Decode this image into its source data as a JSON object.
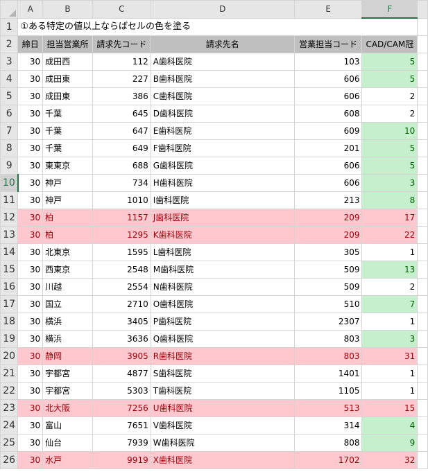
{
  "columns": [
    "A",
    "B",
    "C",
    "D",
    "E",
    "F"
  ],
  "title": "①ある特定の値以上ならばセルの色を塗る",
  "headers": [
    "締日",
    "担当営業所",
    "請求先コード",
    "請求先名",
    "営業担当コード",
    "CAD/CAM冠"
  ],
  "rows": [
    {
      "num": "1"
    },
    {
      "num": "2"
    },
    {
      "num": "3",
      "a": "30",
      "b": "成田西",
      "c": "112",
      "d": "A歯科医院",
      "e": "103",
      "f": "5",
      "hl": "green"
    },
    {
      "num": "4",
      "a": "30",
      "b": "成田東",
      "c": "227",
      "d": "B歯科医院",
      "e": "606",
      "f": "5",
      "hl": "green"
    },
    {
      "num": "5",
      "a": "30",
      "b": "成田東",
      "c": "386",
      "d": "C歯科医院",
      "e": "606",
      "f": "2",
      "hl": "none"
    },
    {
      "num": "6",
      "a": "30",
      "b": "千葉",
      "c": "645",
      "d": "D歯科医院",
      "e": "608",
      "f": "2",
      "hl": "none"
    },
    {
      "num": "7",
      "a": "30",
      "b": "千葉",
      "c": "647",
      "d": "E歯科医院",
      "e": "609",
      "f": "10",
      "hl": "green"
    },
    {
      "num": "8",
      "a": "30",
      "b": "千葉",
      "c": "649",
      "d": "F歯科医院",
      "e": "201",
      "f": "5",
      "hl": "green"
    },
    {
      "num": "9",
      "a": "30",
      "b": "東東京",
      "c": "688",
      "d": "G歯科医院",
      "e": "606",
      "f": "5",
      "hl": "green"
    },
    {
      "num": "10",
      "a": "30",
      "b": "神戸",
      "c": "734",
      "d": "H歯科医院",
      "e": "606",
      "f": "3",
      "hl": "green"
    },
    {
      "num": "11",
      "a": "30",
      "b": "神戸",
      "c": "1010",
      "d": "I歯科医院",
      "e": "213",
      "f": "8",
      "hl": "green"
    },
    {
      "num": "12",
      "a": "30",
      "b": "柏",
      "c": "1157",
      "d": "J歯科医院",
      "e": "209",
      "f": "17",
      "hl": "pink"
    },
    {
      "num": "13",
      "a": "30",
      "b": "柏",
      "c": "1295",
      "d": "K歯科医院",
      "e": "209",
      "f": "22",
      "hl": "pink"
    },
    {
      "num": "14",
      "a": "30",
      "b": "北東京",
      "c": "1595",
      "d": "L歯科医院",
      "e": "305",
      "f": "1",
      "hl": "none"
    },
    {
      "num": "15",
      "a": "30",
      "b": "西東京",
      "c": "2548",
      "d": "M歯科医院",
      "e": "509",
      "f": "13",
      "hl": "green"
    },
    {
      "num": "16",
      "a": "30",
      "b": "川越",
      "c": "2554",
      "d": "N歯科医院",
      "e": "509",
      "f": "2",
      "hl": "none"
    },
    {
      "num": "17",
      "a": "30",
      "b": "国立",
      "c": "2710",
      "d": "O歯科医院",
      "e": "510",
      "f": "7",
      "hl": "green"
    },
    {
      "num": "18",
      "a": "30",
      "b": "横浜",
      "c": "3405",
      "d": "P歯科医院",
      "e": "2307",
      "f": "1",
      "hl": "none"
    },
    {
      "num": "19",
      "a": "30",
      "b": "横浜",
      "c": "3636",
      "d": "Q歯科医院",
      "e": "803",
      "f": "3",
      "hl": "green"
    },
    {
      "num": "20",
      "a": "30",
      "b": "静岡",
      "c": "3905",
      "d": "R歯科医院",
      "e": "803",
      "f": "31",
      "hl": "pink"
    },
    {
      "num": "21",
      "a": "30",
      "b": "宇都宮",
      "c": "4877",
      "d": "S歯科医院",
      "e": "1401",
      "f": "1",
      "hl": "none"
    },
    {
      "num": "22",
      "a": "30",
      "b": "宇都宮",
      "c": "5303",
      "d": "T歯科医院",
      "e": "1105",
      "f": "1",
      "hl": "none"
    },
    {
      "num": "23",
      "a": "30",
      "b": "北大阪",
      "c": "7256",
      "d": "U歯科医院",
      "e": "513",
      "f": "15",
      "hl": "pink"
    },
    {
      "num": "24",
      "a": "30",
      "b": "富山",
      "c": "7651",
      "d": "V歯科医院",
      "e": "314",
      "f": "4",
      "hl": "green"
    },
    {
      "num": "25",
      "a": "30",
      "b": "仙台",
      "c": "7939",
      "d": "W歯科医院",
      "e": "808",
      "f": "9",
      "hl": "green"
    },
    {
      "num": "26",
      "a": "30",
      "b": "水戸",
      "c": "9919",
      "d": "X歯科医院",
      "e": "1702",
      "f": "32",
      "hl": "pink"
    }
  ],
  "colors": {
    "green_fill": "#c6efce",
    "green_text": "#006100",
    "pink_fill": "#ffc7ce",
    "pink_text": "#9c0006",
    "header_fill": "#bfbfbf",
    "active_accent": "#217346"
  }
}
